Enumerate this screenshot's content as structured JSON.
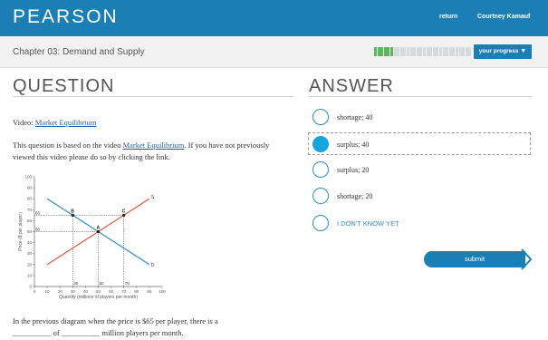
{
  "header": {
    "brand": "PEARSON",
    "return_label": "return",
    "user_name": "Courtney Kamauf"
  },
  "subheader": {
    "chapter": "Chapter 03: Demand and Supply",
    "progress_button": "your progress",
    "progress_fraction": 0.2
  },
  "question": {
    "heading": "QUESTION",
    "video_prefix": "Video: ",
    "video_link": "Market Equilibrium",
    "intro_prefix": "This question is based on the video ",
    "intro_link": "Market Equilibrium",
    "intro_suffix": ". If you have not previously viewed this video please do so by clicking the link.",
    "prompt_line1": "In the previous diagram when the price is $65 per player, there is a",
    "prompt_line2": "__________ of __________ million players per month."
  },
  "answer": {
    "heading": "ANSWER",
    "options": [
      {
        "label": "shortage; 40",
        "selected": false
      },
      {
        "label": "surplus; 40",
        "selected": true
      },
      {
        "label": "surplus; 20",
        "selected": false
      },
      {
        "label": "shortage; 20",
        "selected": false
      },
      {
        "label": "I DON'T KNOW YET",
        "selected": false
      }
    ],
    "submit_label": "submit"
  },
  "chart_data": {
    "type": "line",
    "xlabel": "Quantity (millions of players per month)",
    "ylabel": "Price ($ per player)",
    "xlim": [
      0,
      100
    ],
    "ylim": [
      0,
      100
    ],
    "x_ticks": [
      0,
      10,
      20,
      30,
      40,
      50,
      60,
      70,
      80,
      90,
      100
    ],
    "y_ticks": [
      0,
      10,
      20,
      30,
      40,
      50,
      60,
      70,
      80,
      90,
      100
    ],
    "series": [
      {
        "name": "S",
        "x": [
          10,
          90
        ],
        "y": [
          20,
          80
        ],
        "color": "#e8563f"
      },
      {
        "name": "D",
        "x": [
          10,
          90
        ],
        "y": [
          80,
          20
        ],
        "color": "#2a8fc5"
      }
    ],
    "points": [
      {
        "label": "A",
        "x": 50,
        "y": 50
      },
      {
        "label": "B",
        "x": 30,
        "y": 65
      },
      {
        "label": "C",
        "x": 70,
        "y": 65
      }
    ],
    "guide_labels": {
      "price_high": "65",
      "price_eq": "50",
      "q_b": "30",
      "q_a": "50",
      "q_c": "70"
    }
  }
}
